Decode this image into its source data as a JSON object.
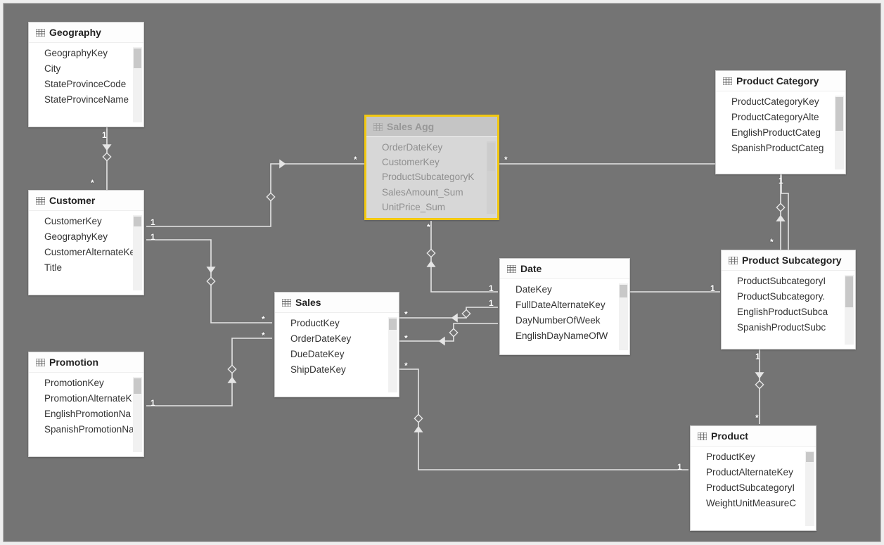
{
  "tables": {
    "geography": {
      "title": "Geography",
      "fields": [
        "GeographyKey",
        "City",
        "StateProvinceCode",
        "StateProvinceName"
      ]
    },
    "customer": {
      "title": "Customer",
      "fields": [
        "CustomerKey",
        "GeographyKey",
        "CustomerAlternateKe",
        "Title"
      ]
    },
    "promotion": {
      "title": "Promotion",
      "fields": [
        "PromotionKey",
        "PromotionAlternateK",
        "EnglishPromotionNa",
        "SpanishPromotionNa"
      ]
    },
    "salesAgg": {
      "title": "Sales Agg",
      "fields": [
        "OrderDateKey",
        "CustomerKey",
        "ProductSubcategoryK",
        "SalesAmount_Sum",
        "UnitPrice_Sum"
      ],
      "sigma": [
        false,
        false,
        false,
        true,
        true
      ]
    },
    "sales": {
      "title": "Sales",
      "fields": [
        "ProductKey",
        "OrderDateKey",
        "DueDateKey",
        "ShipDateKey"
      ],
      "sigma": [
        false,
        true,
        false,
        true
      ]
    },
    "date": {
      "title": "Date",
      "fields": [
        "DateKey",
        "FullDateAlternateKey",
        "DayNumberOfWeek",
        "EnglishDayNameOfW"
      ],
      "sigma": [
        false,
        false,
        true,
        false
      ]
    },
    "productCategory": {
      "title": "Product Category",
      "fields": [
        "ProductCategoryKey",
        "ProductCategoryAlte",
        "EnglishProductCateg",
        "SpanishProductCateg"
      ]
    },
    "productSubcategory": {
      "title": "Product Subcategory",
      "fields": [
        "ProductSubcategoryI",
        "ProductSubcategory.",
        "EnglishProductSubca",
        "SpanishProductSubc"
      ],
      "sigma": [
        false,
        true,
        false,
        false
      ]
    },
    "product": {
      "title": "Product",
      "fields": [
        "ProductKey",
        "ProductAlternateKey",
        "ProductSubcategoryI",
        "WeightUnitMeasureC"
      ]
    }
  },
  "cardinality": {
    "one": "1",
    "many": "*"
  }
}
